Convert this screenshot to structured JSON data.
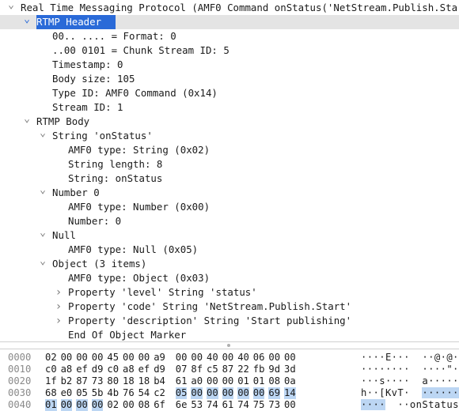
{
  "tree": [
    {
      "depth": 0,
      "toggle": "open",
      "text": "Real Time Messaging Protocol (AMF0 Command onStatus('NetStream.Publish.Sta",
      "selected": false
    },
    {
      "depth": 1,
      "toggle": "open",
      "text": "RTMP Header",
      "selected": true
    },
    {
      "depth": 2,
      "toggle": "none",
      "text": "00.. .... = Format: 0",
      "selected": false
    },
    {
      "depth": 2,
      "toggle": "none",
      "text": "..00 0101 = Chunk Stream ID: 5",
      "selected": false
    },
    {
      "depth": 2,
      "toggle": "none",
      "text": "Timestamp: 0",
      "selected": false
    },
    {
      "depth": 2,
      "toggle": "none",
      "text": "Body size: 105",
      "selected": false
    },
    {
      "depth": 2,
      "toggle": "none",
      "text": "Type ID: AMF0 Command (0x14)",
      "selected": false
    },
    {
      "depth": 2,
      "toggle": "none",
      "text": "Stream ID: 1",
      "selected": false
    },
    {
      "depth": 1,
      "toggle": "open",
      "text": "RTMP Body",
      "selected": false
    },
    {
      "depth": 2,
      "toggle": "open",
      "text": "String 'onStatus'",
      "selected": false
    },
    {
      "depth": 3,
      "toggle": "none",
      "text": "AMF0 type: String (0x02)",
      "selected": false
    },
    {
      "depth": 3,
      "toggle": "none",
      "text": "String length: 8",
      "selected": false
    },
    {
      "depth": 3,
      "toggle": "none",
      "text": "String: onStatus",
      "selected": false
    },
    {
      "depth": 2,
      "toggle": "open",
      "text": "Number 0",
      "selected": false
    },
    {
      "depth": 3,
      "toggle": "none",
      "text": "AMF0 type: Number (0x00)",
      "selected": false
    },
    {
      "depth": 3,
      "toggle": "none",
      "text": "Number: 0",
      "selected": false
    },
    {
      "depth": 2,
      "toggle": "open",
      "text": "Null",
      "selected": false
    },
    {
      "depth": 3,
      "toggle": "none",
      "text": "AMF0 type: Null (0x05)",
      "selected": false
    },
    {
      "depth": 2,
      "toggle": "open",
      "text": "Object (3 items)",
      "selected": false
    },
    {
      "depth": 3,
      "toggle": "none",
      "text": "AMF0 type: Object (0x03)",
      "selected": false
    },
    {
      "depth": 3,
      "toggle": "closed",
      "text": "Property 'level' String 'status'",
      "selected": false
    },
    {
      "depth": 3,
      "toggle": "closed",
      "text": "Property 'code' String 'NetStream.Publish.Start'",
      "selected": false
    },
    {
      "depth": 3,
      "toggle": "closed",
      "text": "Property 'description' String 'Start publishing'",
      "selected": false
    },
    {
      "depth": 3,
      "toggle": "none",
      "text": "End Of Object Marker",
      "selected": false
    }
  ],
  "hex": [
    {
      "offset": "0000",
      "bytes": [
        "02",
        "00",
        "00",
        "00",
        "45",
        "00",
        "00",
        "a9",
        "00",
        "00",
        "40",
        "00",
        "40",
        "06",
        "00",
        "00"
      ],
      "hl": [],
      "ascii": "····E···  ··@·@···"
    },
    {
      "offset": "0010",
      "bytes": [
        "c0",
        "a8",
        "ef",
        "d9",
        "c0",
        "a8",
        "ef",
        "d9",
        "07",
        "8f",
        "c5",
        "87",
        "22",
        "fb",
        "9d",
        "3d"
      ],
      "hl": [],
      "ascii": "········  ····\"··="
    },
    {
      "offset": "0020",
      "bytes": [
        "1f",
        "b2",
        "87",
        "73",
        "80",
        "18",
        "18",
        "b4",
        "61",
        "a0",
        "00",
        "00",
        "01",
        "01",
        "08",
        "0a"
      ],
      "hl": [],
      "ascii": "···s····  a·······"
    },
    {
      "offset": "0030",
      "bytes": [
        "68",
        "e0",
        "05",
        "5b",
        "4b",
        "76",
        "54",
        "c2",
        "05",
        "00",
        "00",
        "00",
        "00",
        "00",
        "69",
        "14"
      ],
      "hl": [
        8,
        9,
        10,
        11,
        12,
        13,
        14,
        15
      ],
      "ascii": "h··[KvT·  ······i·"
    },
    {
      "offset": "0040",
      "bytes": [
        "01",
        "00",
        "00",
        "00",
        "02",
        "00",
        "08",
        "6f",
        "6e",
        "53",
        "74",
        "61",
        "74",
        "75",
        "73",
        "00"
      ],
      "hl": [
        0,
        1,
        2,
        3
      ],
      "ascii": "····  ··onStatus·"
    }
  ],
  "icons": {
    "open": "chevron-down-icon",
    "closed": "chevron-right-icon"
  },
  "colors": {
    "selection": "#2a6ad8",
    "selection_row": "#e4e4e4",
    "hex_highlight": "#bcd6f3"
  }
}
